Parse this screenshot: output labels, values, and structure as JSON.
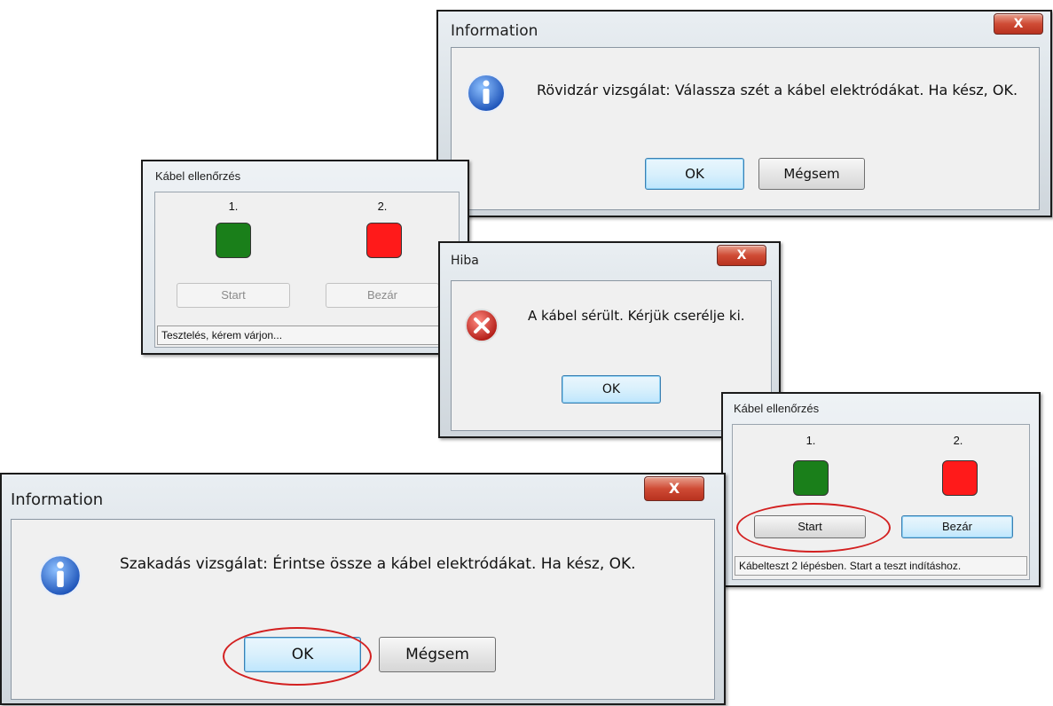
{
  "dialog_info_top": {
    "title": "Information",
    "close_label": "X",
    "message": "Rövidzár vizsgálat: Válassza szét a kábel elektródákat. Ha kész, OK.",
    "ok_label": "OK",
    "cancel_label": "Mégsem",
    "icon": "info-icon"
  },
  "cable_check_1": {
    "title": "Kábel ellenőrzés",
    "led1_label": "1.",
    "led2_label": "2.",
    "led1_color": "#1a7f1a",
    "led2_color": "#ff1a1a",
    "start_label": "Start",
    "close_label": "Bezár",
    "status": "Tesztelés, kérem várjon..."
  },
  "dialog_error": {
    "title": "Hiba",
    "close_label": "X",
    "message": "A kábel sérült. Kérjük cserélje ki.",
    "ok_label": "OK",
    "icon": "error-icon"
  },
  "cable_check_2": {
    "title": "Kábel ellenőrzés",
    "led1_label": "1.",
    "led2_label": "2.",
    "led1_color": "#1a7f1a",
    "led2_color": "#ff1a1a",
    "start_label": "Start",
    "close_label": "Bezár",
    "status": "Kábelteszt 2 lépésben. Start a teszt indításhoz."
  },
  "dialog_info_bottom": {
    "title": "Information",
    "close_label": "X",
    "message": "Szakadás vizsgálat: Érintse össze a kábel elektródákat. Ha kész, OK.",
    "ok_label": "OK",
    "cancel_label": "Mégsem",
    "icon": "info-icon"
  },
  "highlight_color": "#d32020"
}
